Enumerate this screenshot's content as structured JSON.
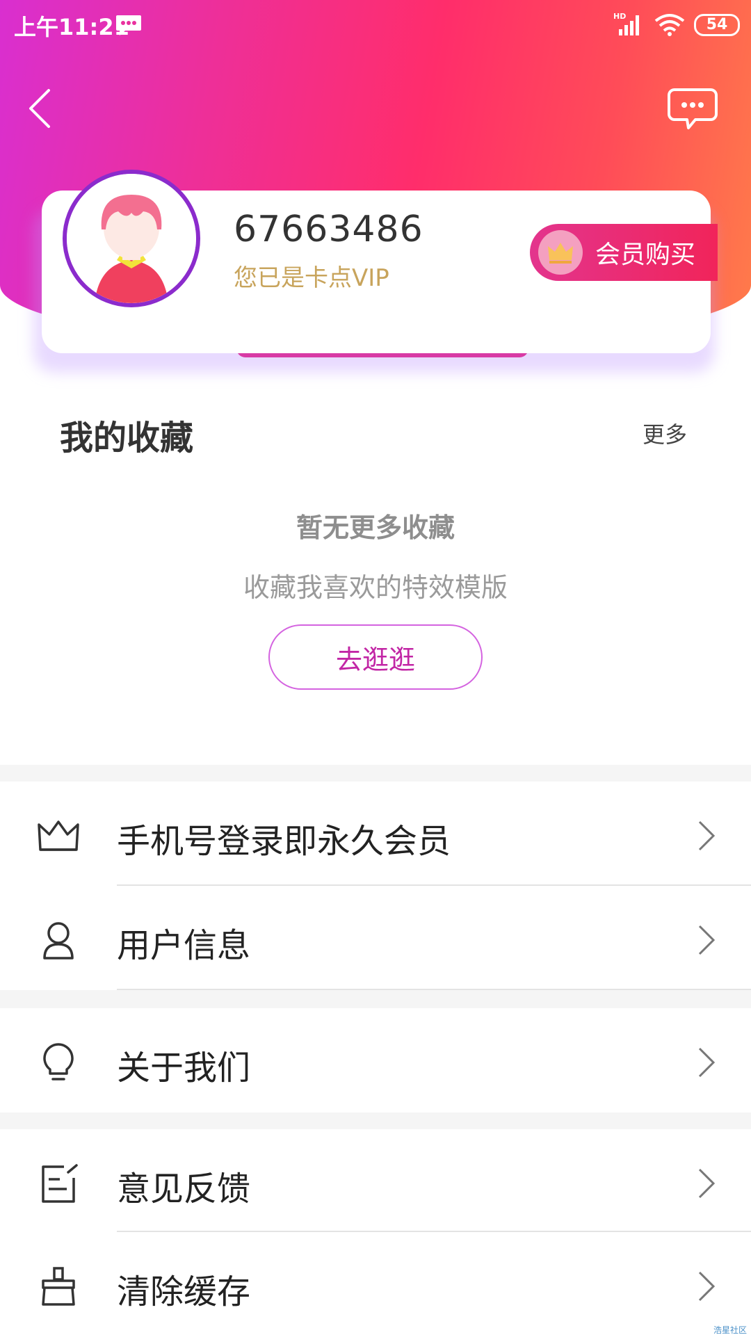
{
  "status_bar": {
    "time": "上午11:21",
    "battery": "54"
  },
  "profile": {
    "user_id": "67663486",
    "vip_status": "您已是卡点VIP",
    "member_buy_label": "会员购买"
  },
  "favorites": {
    "title": "我的收藏",
    "more_label": "更多",
    "empty_title": "暂无更多收藏",
    "empty_desc": "收藏我喜欢的特效模版",
    "browse_label": "去逛逛"
  },
  "menu": {
    "items": [
      {
        "label": "手机号登录即永久会员",
        "icon": "crown-icon"
      },
      {
        "label": "用户信息",
        "icon": "user-icon"
      },
      {
        "label": "关于我们",
        "icon": "lightbulb-icon"
      },
      {
        "label": "意见反馈",
        "icon": "feedback-icon"
      },
      {
        "label": "清除缓存",
        "icon": "broom-icon"
      }
    ]
  },
  "watermark": "浩星社区",
  "colors": {
    "gradient_start": "#d92fd0",
    "gradient_mid": "#ff2d6b",
    "gradient_end": "#ff7c4a",
    "vip_gold": "#c8a45c",
    "accent_magenta": "#c226a5"
  }
}
